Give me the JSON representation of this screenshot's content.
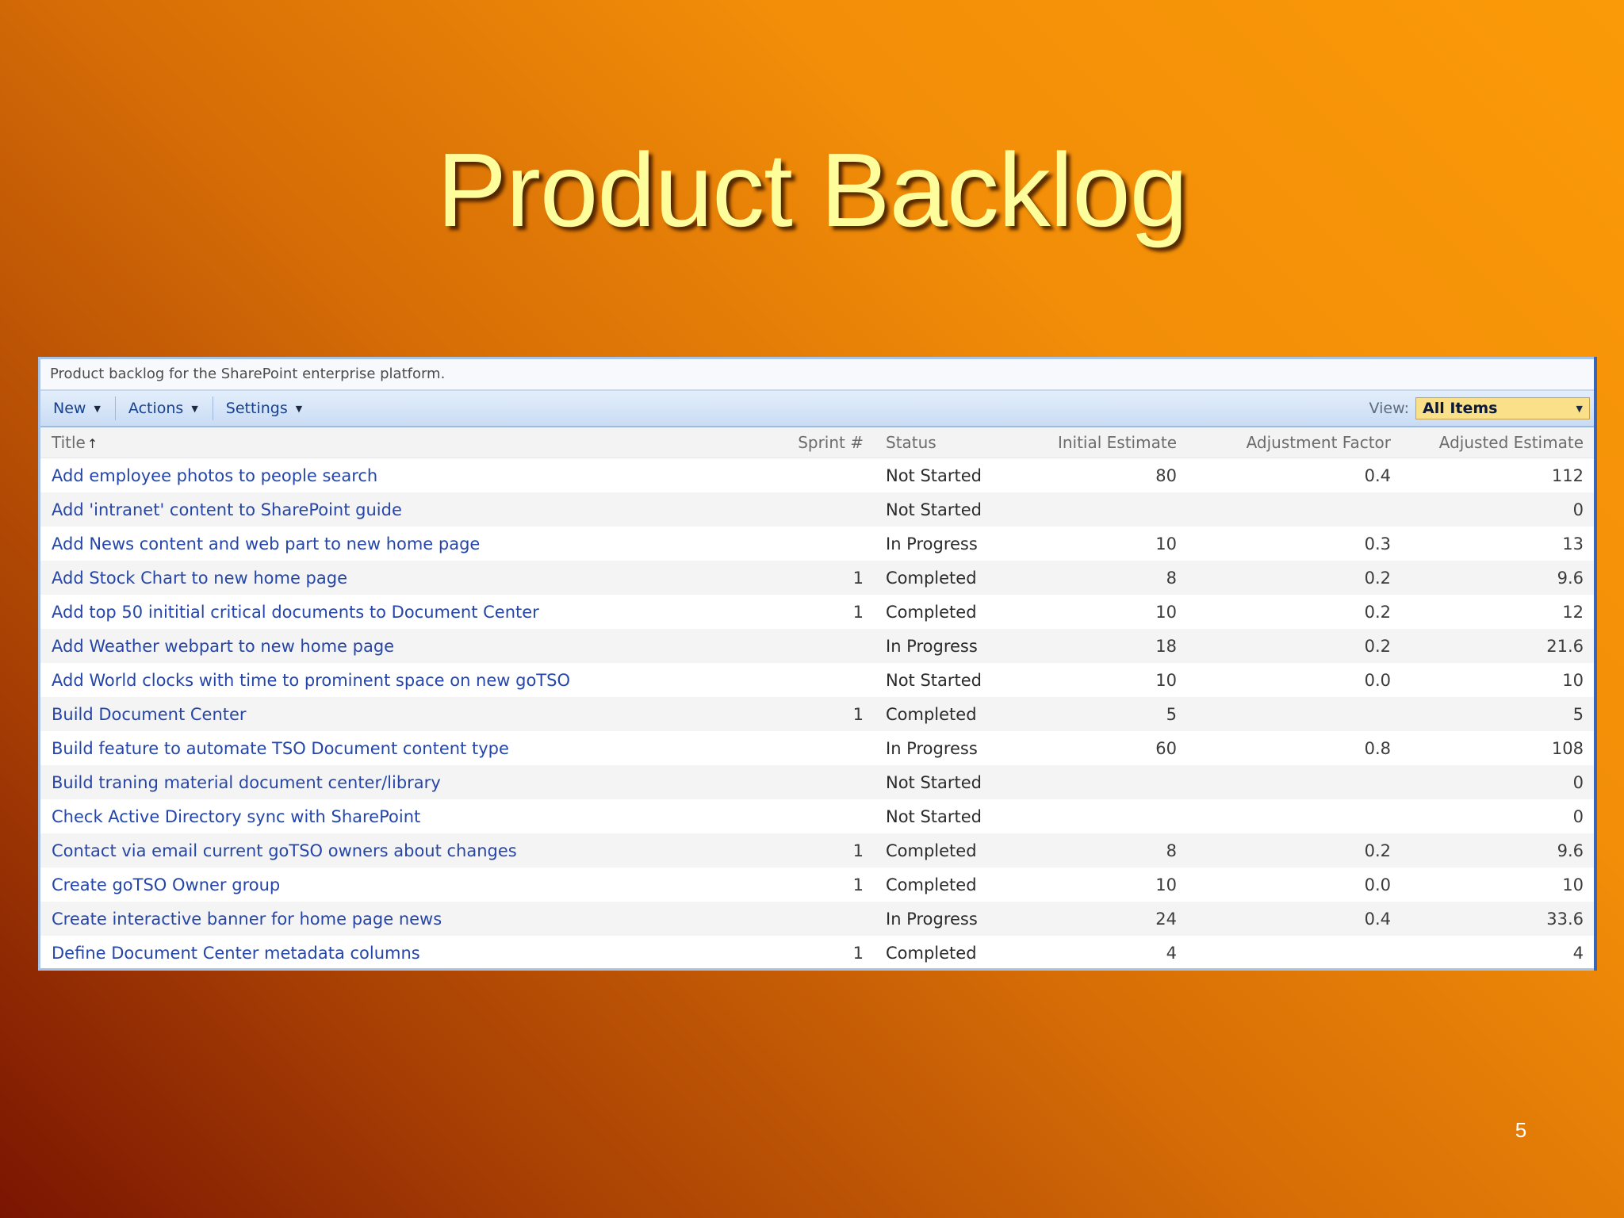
{
  "slide": {
    "title": "Product Backlog",
    "page_number": "5"
  },
  "list": {
    "description": "Product backlog for the SharePoint enterprise platform.",
    "toolbar": {
      "new_label": "New",
      "actions_label": "Actions",
      "settings_label": "Settings",
      "view_label": "View:",
      "view_value": "All Items"
    },
    "columns": {
      "title": "Title",
      "sprint": "Sprint #",
      "status": "Status",
      "initial_estimate": "Initial Estimate",
      "adjustment_factor": "Adjustment Factor",
      "adjusted_estimate": "Adjusted Estimate"
    },
    "sort_icon": "sort-ascending-arrow",
    "rows": [
      {
        "title": "Add employee photos to people search",
        "sprint": "",
        "status": "Not Started",
        "initial_estimate": "80",
        "adjustment_factor": "0.4",
        "adjusted_estimate": "112"
      },
      {
        "title": "Add 'intranet' content to SharePoint guide",
        "sprint": "",
        "status": "Not Started",
        "initial_estimate": "",
        "adjustment_factor": "",
        "adjusted_estimate": "0"
      },
      {
        "title": "Add News content and web part to new home page",
        "sprint": "",
        "status": "In Progress",
        "initial_estimate": "10",
        "adjustment_factor": "0.3",
        "adjusted_estimate": "13"
      },
      {
        "title": "Add Stock Chart to new home page",
        "sprint": "1",
        "status": "Completed",
        "initial_estimate": "8",
        "adjustment_factor": "0.2",
        "adjusted_estimate": "9.6"
      },
      {
        "title": "Add top 50 inititial critical documents to Document Center",
        "sprint": "1",
        "status": "Completed",
        "initial_estimate": "10",
        "adjustment_factor": "0.2",
        "adjusted_estimate": "12"
      },
      {
        "title": "Add Weather webpart to new home page",
        "sprint": "",
        "status": "In Progress",
        "initial_estimate": "18",
        "adjustment_factor": "0.2",
        "adjusted_estimate": "21.6"
      },
      {
        "title": "Add World clocks with time to prominent space on new goTSO",
        "sprint": "",
        "status": "Not Started",
        "initial_estimate": "10",
        "adjustment_factor": "0.0",
        "adjusted_estimate": "10"
      },
      {
        "title": "Build Document Center",
        "sprint": "1",
        "status": "Completed",
        "initial_estimate": "5",
        "adjustment_factor": "",
        "adjusted_estimate": "5"
      },
      {
        "title": "Build feature to automate TSO Document content type",
        "sprint": "",
        "status": "In Progress",
        "initial_estimate": "60",
        "adjustment_factor": "0.8",
        "adjusted_estimate": "108"
      },
      {
        "title": "Build traning material document center/library",
        "sprint": "",
        "status": "Not Started",
        "initial_estimate": "",
        "adjustment_factor": "",
        "adjusted_estimate": "0"
      },
      {
        "title": "Check Active Directory sync with SharePoint",
        "sprint": "",
        "status": "Not Started",
        "initial_estimate": "",
        "adjustment_factor": "",
        "adjusted_estimate": "0"
      },
      {
        "title": "Contact via email current goTSO owners about changes",
        "sprint": "1",
        "status": "Completed",
        "initial_estimate": "8",
        "adjustment_factor": "0.2",
        "adjusted_estimate": "9.6"
      },
      {
        "title": "Create goTSO Owner group",
        "sprint": "1",
        "status": "Completed",
        "initial_estimate": "10",
        "adjustment_factor": "0.0",
        "adjusted_estimate": "10"
      },
      {
        "title": "Create interactive banner for home page news",
        "sprint": "",
        "status": "In Progress",
        "initial_estimate": "24",
        "adjustment_factor": "0.4",
        "adjusted_estimate": "33.6"
      },
      {
        "title": "Define Document Center metadata columns",
        "sprint": "1",
        "status": "Completed",
        "initial_estimate": "4",
        "adjustment_factor": "",
        "adjusted_estimate": "4"
      }
    ]
  }
}
